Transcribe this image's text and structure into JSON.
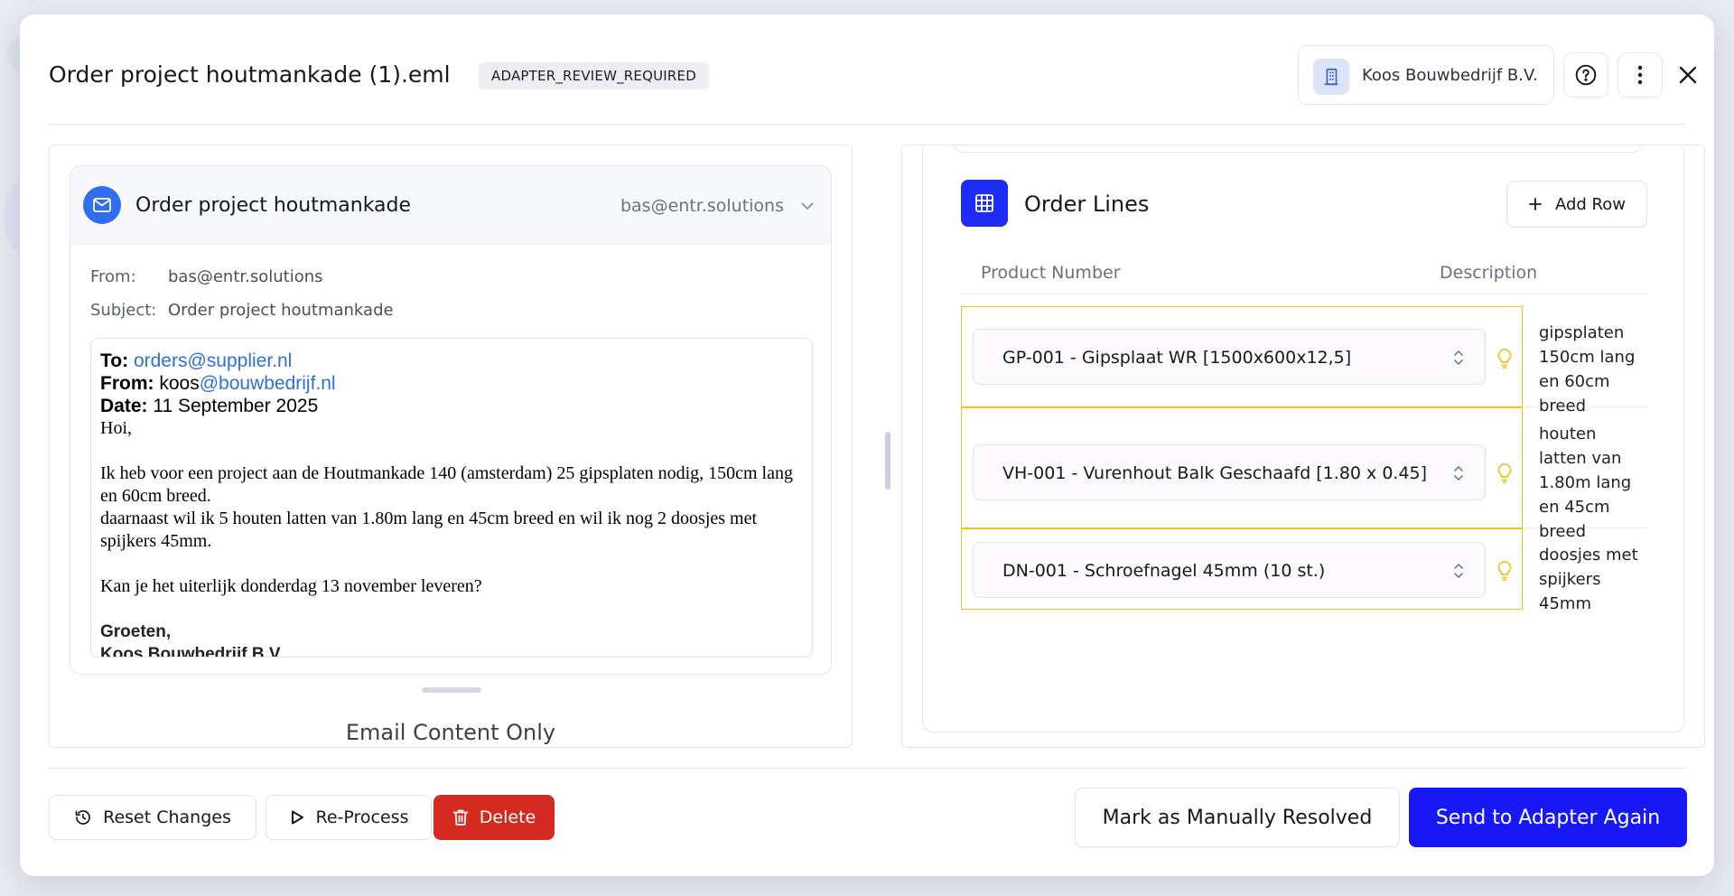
{
  "header": {
    "title": "Order project houtmankade (1).eml",
    "status_badge": "ADAPTER_REVIEW_REQUIRED",
    "company": "Koos Bouwbedrijf B.V."
  },
  "email": {
    "subject_title": "Order project houtmankade",
    "sender": "bas@entr.solutions",
    "from_label": "From:",
    "from_value": "bas@entr.solutions",
    "subject_label": "Subject:",
    "subject_value": "Order project houtmankade",
    "body": {
      "to_label": "To:",
      "to_value": "orders@supplier.nl",
      "from_label": "From:",
      "from_name": "koos",
      "from_domain": "@bouwbedrijf.nl",
      "date_label": "Date:",
      "date_value": "11 September 2025",
      "greeting": "Hoi,",
      "paragraph1": "Ik heb voor een project aan de Houtmankade 140 (amsterdam) 25 gipsplaten nodig, 150cm lang en 60cm breed.",
      "paragraph2": "daarnaast wil ik 5 houten latten van 1.80m lang en 45cm breed en wil ik nog 2 doosjes met spijkers 45mm.",
      "paragraph3": "Kan je het uiterlijk donderdag 13 november leveren?",
      "closing": "Groeten,",
      "signature": "Koos Bouwbedrijf B.V"
    },
    "view_label": "Email Content Only"
  },
  "order_lines": {
    "title": "Order Lines",
    "add_row_label": "Add Row",
    "columns": {
      "product": "Product Number",
      "description": "Description"
    },
    "rows": [
      {
        "product": "GP-001 - Gipsplaat WR [1500x600x12,5]",
        "description": "gipsplaten 150cm lang en 60cm breed"
      },
      {
        "product": "VH-001 - Vurenhout Balk Geschaafd [1.80 x 0.45]",
        "description": "houten latten van 1.80m lang en 45cm breed"
      },
      {
        "product": "DN-001 - Schroefnagel 45mm (10 st.)",
        "description": "doosjes met spijkers 45mm"
      }
    ]
  },
  "footer": {
    "reset_label": "Reset Changes",
    "reprocess_label": "Re-Process",
    "delete_label": "Delete",
    "manual_label": "Mark as Manually Resolved",
    "send_label": "Send to Adapter Again"
  },
  "colors": {
    "primary": "#1818f5",
    "danger": "#d42a22",
    "mail_icon": "#2f6ef0",
    "highlight_border": "#f0c514",
    "link": "#2f6ee0"
  },
  "icons": [
    "building-icon",
    "help-icon",
    "more-vertical-icon",
    "close-icon",
    "mail-icon",
    "chevron-down-icon",
    "table-icon",
    "plus-icon",
    "updown-icon",
    "lightbulb-icon",
    "history-icon",
    "play-icon",
    "trash-icon"
  ]
}
